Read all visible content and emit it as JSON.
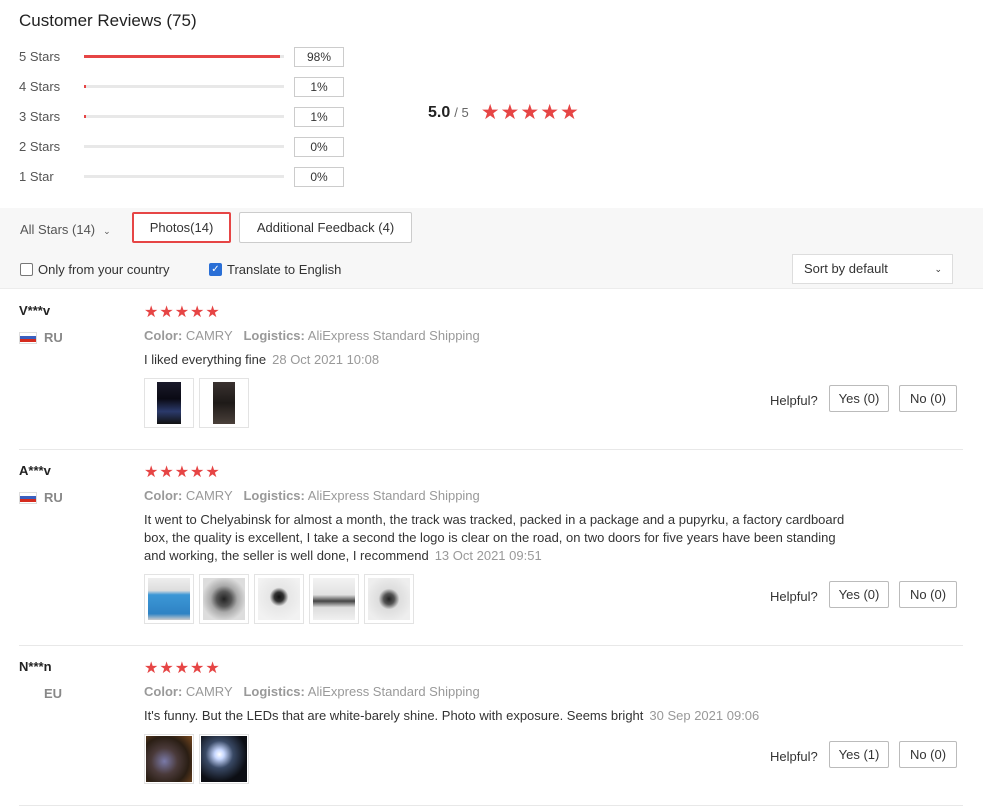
{
  "header": {
    "title": "Customer Reviews (75)"
  },
  "distribution": [
    {
      "label": "5 Stars",
      "percent": "98%",
      "fraction": 0.98
    },
    {
      "label": "4 Stars",
      "percent": "1%",
      "fraction": 0.01
    },
    {
      "label": "3 Stars",
      "percent": "1%",
      "fraction": 0.01
    },
    {
      "label": "2 Stars",
      "percent": "0%",
      "fraction": 0
    },
    {
      "label": "1 Star",
      "percent": "0%",
      "fraction": 0
    }
  ],
  "average": {
    "score": "5.0",
    "out_of": "/ 5",
    "stars": 5
  },
  "filters": {
    "all_stars": "All Stars (14)",
    "photos": "Photos(14)",
    "additional": "Additional Feedback (4)",
    "only_country": "Only from your country",
    "translate": "Translate to English",
    "sort": "Sort by default"
  },
  "colors": {
    "accent": "#e64545",
    "checkbox": "#2a6fd6"
  },
  "reviews": [
    {
      "name": "V***v",
      "country": "RU",
      "stars": 5,
      "color_label": "Color:",
      "color_value": "CAMRY",
      "logistics_label": "Logistics:",
      "logistics_value": "AliExpress Standard Shipping",
      "text": "I liked everything fine",
      "date": "28 Oct 2021 10:08",
      "helpful": "Helpful?",
      "yes": "Yes (0)",
      "no": "No (0)"
    },
    {
      "name": "A***v",
      "country": "RU",
      "stars": 5,
      "color_label": "Color:",
      "color_value": "CAMRY",
      "logistics_label": "Logistics:",
      "logistics_value": "AliExpress Standard Shipping",
      "text": "It went to Chelyabinsk for almost a month, the track was tracked, packed in a package and a pupyrku, a factory cardboard box, the quality is excellent, I take a second the logo is clear on the road, on two doors for five years have been standing and working, the seller is well done, I recommend",
      "date": "13 Oct 2021 09:51",
      "helpful": "Helpful?",
      "yes": "Yes (0)",
      "no": "No (0)"
    },
    {
      "name": "N***n",
      "country": "EU",
      "stars": 5,
      "color_label": "Color:",
      "color_value": "CAMRY",
      "logistics_label": "Logistics:",
      "logistics_value": "AliExpress Standard Shipping",
      "text": "It's funny. But the LEDs that are white-barely shine. Photo with exposure. Seems bright",
      "date": "30 Sep 2021 09:06",
      "helpful": "Helpful?",
      "yes": "Yes (1)",
      "no": "No (0)"
    }
  ]
}
